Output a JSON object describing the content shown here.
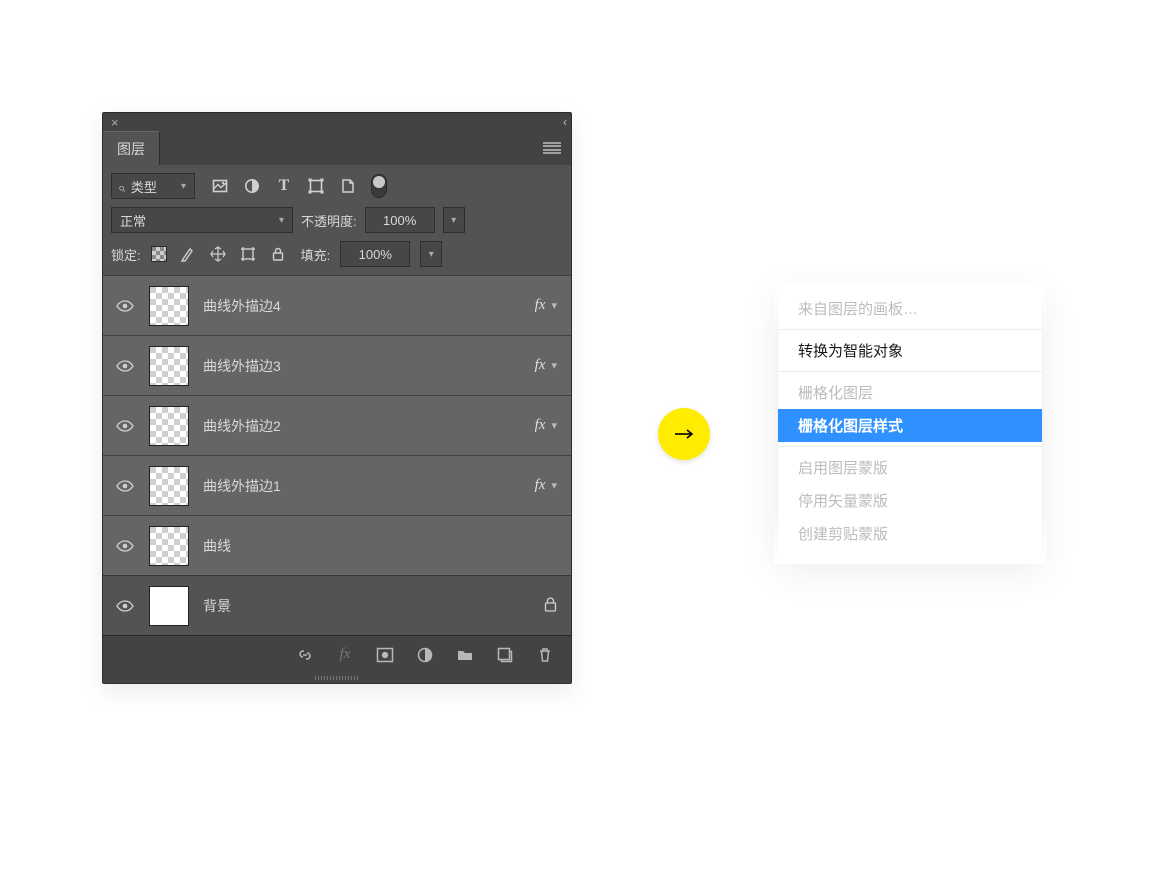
{
  "panel": {
    "title": "图层",
    "filter": {
      "type_label": "类型"
    },
    "blend": {
      "mode": "正常",
      "opacity_label": "不透明度:",
      "opacity_value": "100%"
    },
    "lock": {
      "label": "锁定:",
      "fill_label": "填充:",
      "fill_value": "100%"
    },
    "fx_label": "fx",
    "layers": [
      {
        "name": "曲线外描边4",
        "fx": true,
        "selected": true,
        "locked": false
      },
      {
        "name": "曲线外描边3",
        "fx": true,
        "selected": true,
        "locked": false
      },
      {
        "name": "曲线外描边2",
        "fx": true,
        "selected": true,
        "locked": false
      },
      {
        "name": "曲线外描边1",
        "fx": true,
        "selected": true,
        "locked": false
      },
      {
        "name": "曲线",
        "fx": false,
        "selected": true,
        "locked": false
      },
      {
        "name": "背景",
        "fx": false,
        "selected": false,
        "locked": true
      }
    ]
  },
  "context_menu": {
    "items": [
      {
        "label": "来自图层的画板…",
        "dim": true,
        "sel": false
      },
      {
        "label": "转换为智能对象",
        "dim": false,
        "sel": false,
        "sep_before": true
      },
      {
        "label": "栅格化图层",
        "dim": true,
        "sel": false,
        "sep_before": true
      },
      {
        "label": "栅格化图层样式",
        "dim": false,
        "sel": true
      },
      {
        "label": "启用图层蒙版",
        "dim": true,
        "sel": false,
        "sep_before": true
      },
      {
        "label": "停用矢量蒙版",
        "dim": true,
        "sel": false
      },
      {
        "label": "创建剪贴蒙版",
        "dim": true,
        "sel": false
      }
    ]
  }
}
